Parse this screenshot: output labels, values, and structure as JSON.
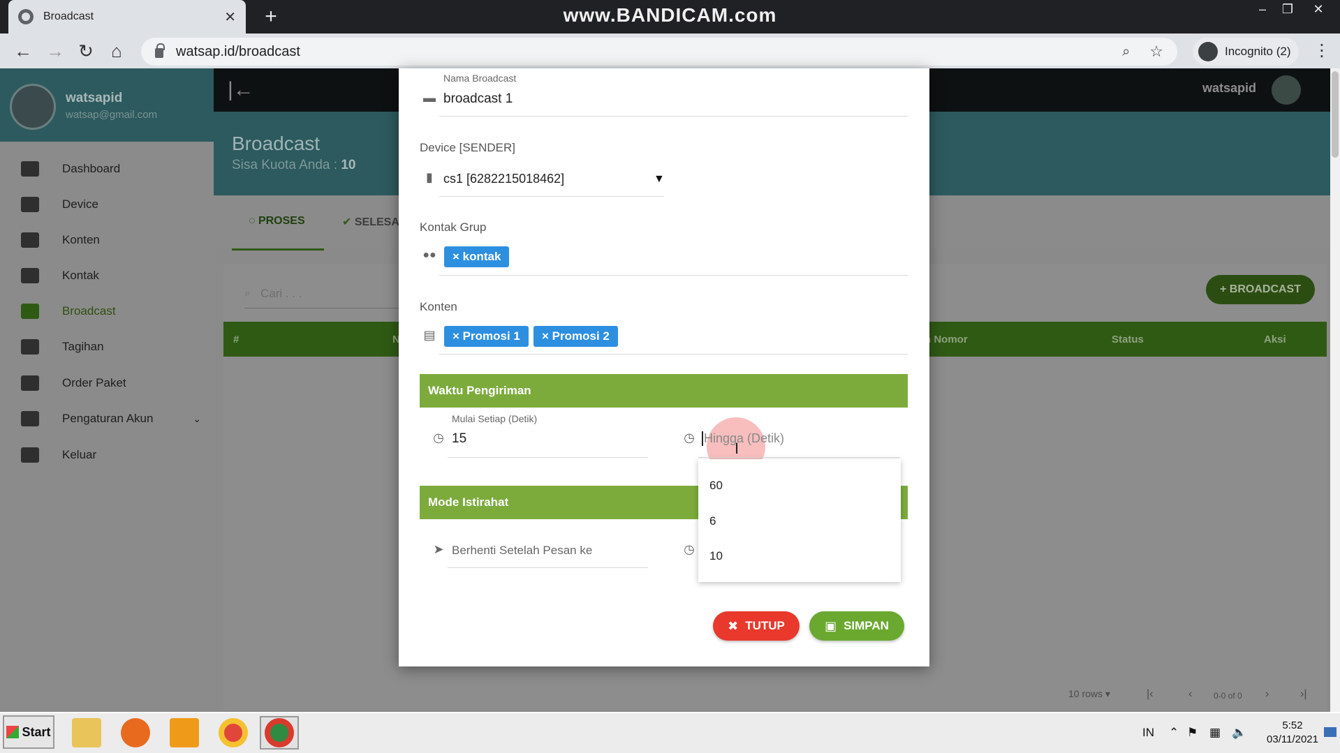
{
  "browser": {
    "tab_title": "Broadcast",
    "new_tab": "+",
    "watermark": "www.BANDICAM.com",
    "url": "watsap.id/broadcast",
    "incognito": "Incognito (2)",
    "win_min": "–",
    "win_max": "❐",
    "win_close": "✕"
  },
  "sidebar": {
    "username": "watsapid",
    "email": "watsap@gmail.com",
    "items": [
      {
        "label": "Dashboard"
      },
      {
        "label": "Device"
      },
      {
        "label": "Konten"
      },
      {
        "label": "Kontak"
      },
      {
        "label": "Broadcast"
      },
      {
        "label": "Tagihan"
      },
      {
        "label": "Order Paket"
      },
      {
        "label": "Pengaturan Akun"
      },
      {
        "label": "Keluar"
      }
    ]
  },
  "topbar": {
    "username": "watsapid"
  },
  "page": {
    "title": "Broadcast",
    "quota_label": "Sisa Kuota Anda : ",
    "quota_value": "10",
    "tab_proses": "PROSES",
    "tab_selesai": "SELESAI",
    "search_placeholder": "Cari . . .",
    "add_button": "+ BROADCAST",
    "columns": [
      "#",
      "N",
      "h Nomor",
      "Status",
      "Aksi"
    ],
    "rows_per_page": "10 rows",
    "page_info": "0-0 of 0"
  },
  "modal": {
    "nama_label": "Nama Broadcast",
    "nama_value": "broadcast 1",
    "device_label": "Device [SENDER]",
    "device_value": "cs1 [6282215018462]",
    "kontak_label": "Kontak Grup",
    "kontak_chips": [
      "× kontak"
    ],
    "konten_label": "Konten",
    "konten_chips": [
      "× Promosi 1",
      "× Promosi 2"
    ],
    "waktu_header": "Waktu Pengiriman",
    "mulai_label": "Mulai Setiap (Detik)",
    "mulai_value": "15",
    "hingga_placeholder": "Hingga (Detik)",
    "hingga_options": [
      "60",
      "6",
      "10"
    ],
    "mode_header": "Mode Istirahat",
    "berhenti_placeholder": "Berhenti Setelah Pesan ke",
    "btn_tutup": "TUTUP",
    "btn_simpan": "SIMPAN"
  },
  "taskbar": {
    "start": "Start",
    "lang": "IN",
    "time": "5:52",
    "date": "03/11/2021"
  },
  "colors": {
    "green_bar": "#7cab3c",
    "chip_blue": "#2d8fe0",
    "btn_red": "#e8392c",
    "btn_green": "#6aa82f"
  }
}
